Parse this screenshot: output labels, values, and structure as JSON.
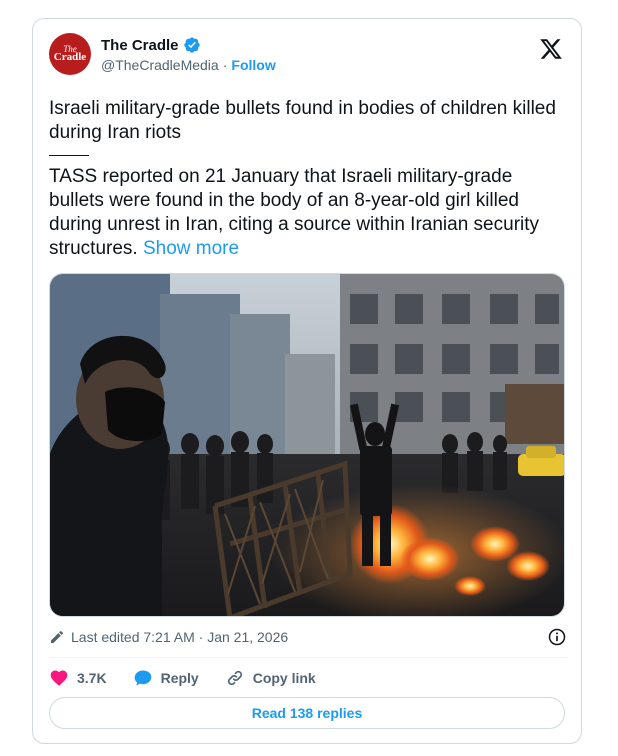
{
  "author": {
    "avatar_line1": "The",
    "avatar_line2": "Cradle",
    "display_name": "The Cradle",
    "handle": "@TheCradleMedia",
    "separator": "·",
    "follow_label": "Follow"
  },
  "post": {
    "headline": "Israeli military-grade bullets found in bodies of children killed during Iran riots",
    "body": "TASS reported on 21 January that Israeli military-grade bullets were found in the body of an 8-year-old girl killed during unrest in Iran, citing a source within Iranian security structures.",
    "show_more": "Show more",
    "edited_label": "Last edited 7:21 AM · Jan 21, 2026"
  },
  "actions": {
    "likes": "3.7K",
    "reply_label": "Reply",
    "copy_link_label": "Copy link"
  },
  "read_replies_label": "Read 138 replies",
  "colors": {
    "accent": "#1d9bf0",
    "like": "#f91880",
    "avatar": "#b91c1c",
    "secondary_text": "#536471"
  },
  "icons": [
    "verified-badge-icon",
    "x-logo-icon",
    "pencil-icon",
    "info-icon",
    "heart-icon",
    "reply-bubble-icon",
    "link-icon"
  ]
}
